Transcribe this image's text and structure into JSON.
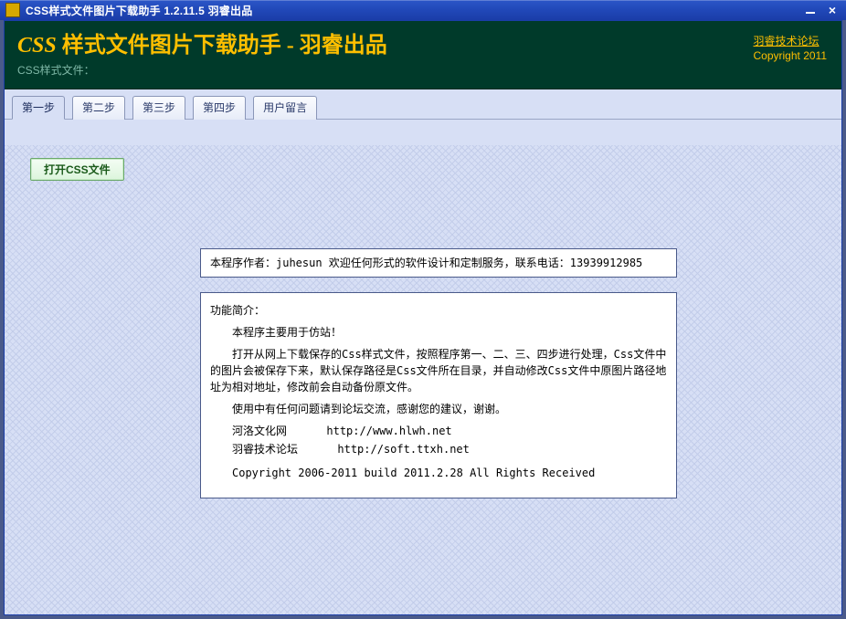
{
  "window": {
    "title": "CSS样式文件图片下载助手  1.2.11.5   羽睿出品"
  },
  "header": {
    "main_title_prefix": "CSS",
    "main_title_rest": "样式文件图片下载助手 - 羽睿出品",
    "sub_label": "CSS样式文件：",
    "forum_link": "羽睿技术论坛",
    "copyright": "Copyright 2011"
  },
  "tabs": [
    {
      "label": "第一步",
      "active": true
    },
    {
      "label": "第二步",
      "active": false
    },
    {
      "label": "第三步",
      "active": false
    },
    {
      "label": "第四步",
      "active": false
    },
    {
      "label": "用户留言",
      "active": false
    }
  ],
  "content": {
    "open_button": "打开CSS文件",
    "author_line": "本程序作者：juhesun       欢迎任何形式的软件设计和定制服务，联系电话：13939912985",
    "intro": {
      "heading": "功能简介：",
      "p1": "本程序主要用于仿站！",
      "p2": "打开从网上下载保存的Css样式文件，按照程序第一、二、三、四步进行处理，Css文件中的图片会被保存下来，默认保存路径是Css文件所在目录，并自动修改Css文件中原图片路径地址为相对地址，修改前会自动备份原文件。",
      "p3": "使用中有任何问题请到论坛交流，感谢您的建议，谢谢。",
      "link1_label": "河洛文化网",
      "link1_url": "http://www.hlwh.net",
      "link2_label": "羽睿技术论坛",
      "link2_url": "http://soft.ttxh.net",
      "copy": "Copyright 2006-2011  build 2011.2.28  All Rights Received"
    }
  }
}
